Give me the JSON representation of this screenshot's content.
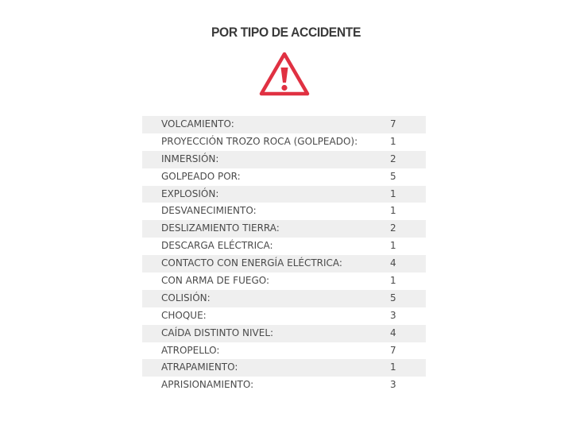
{
  "title": "POR TIPO DE ACCIDENTE",
  "icon": "warning-triangle-icon",
  "colors": {
    "icon": "#e03142",
    "row_shade": "#efefef",
    "text": "#4a4a4a"
  },
  "table": {
    "rows": [
      {
        "label": "VOLCAMIENTO:",
        "value": "7"
      },
      {
        "label": "PROYECCIÓN TROZO ROCA (GOLPEADO):",
        "value": "1"
      },
      {
        "label": "INMERSIÓN:",
        "value": "2"
      },
      {
        "label": "GOLPEADO POR:",
        "value": "5"
      },
      {
        "label": "EXPLOSIÓN:",
        "value": "1"
      },
      {
        "label": "DESVANECIMIENTO:",
        "value": "1"
      },
      {
        "label": "DESLIZAMIENTO TIERRA:",
        "value": "2"
      },
      {
        "label": "DESCARGA ELÉCTRICA:",
        "value": "1"
      },
      {
        "label": "CONTACTO CON ENERGÍA ELÉCTRICA:",
        "value": "4"
      },
      {
        "label": "CON ARMA DE FUEGO:",
        "value": "1"
      },
      {
        "label": "COLISIÓN:",
        "value": "5"
      },
      {
        "label": "CHOQUE:",
        "value": "3"
      },
      {
        "label": "CAÍDA DISTINTO NIVEL:",
        "value": "4"
      },
      {
        "label": "ATROPELLO:",
        "value": "7"
      },
      {
        "label": "ATRAPAMIENTO:",
        "value": "1"
      },
      {
        "label": "APRISIONAMIENTO:",
        "value": "3"
      }
    ]
  }
}
